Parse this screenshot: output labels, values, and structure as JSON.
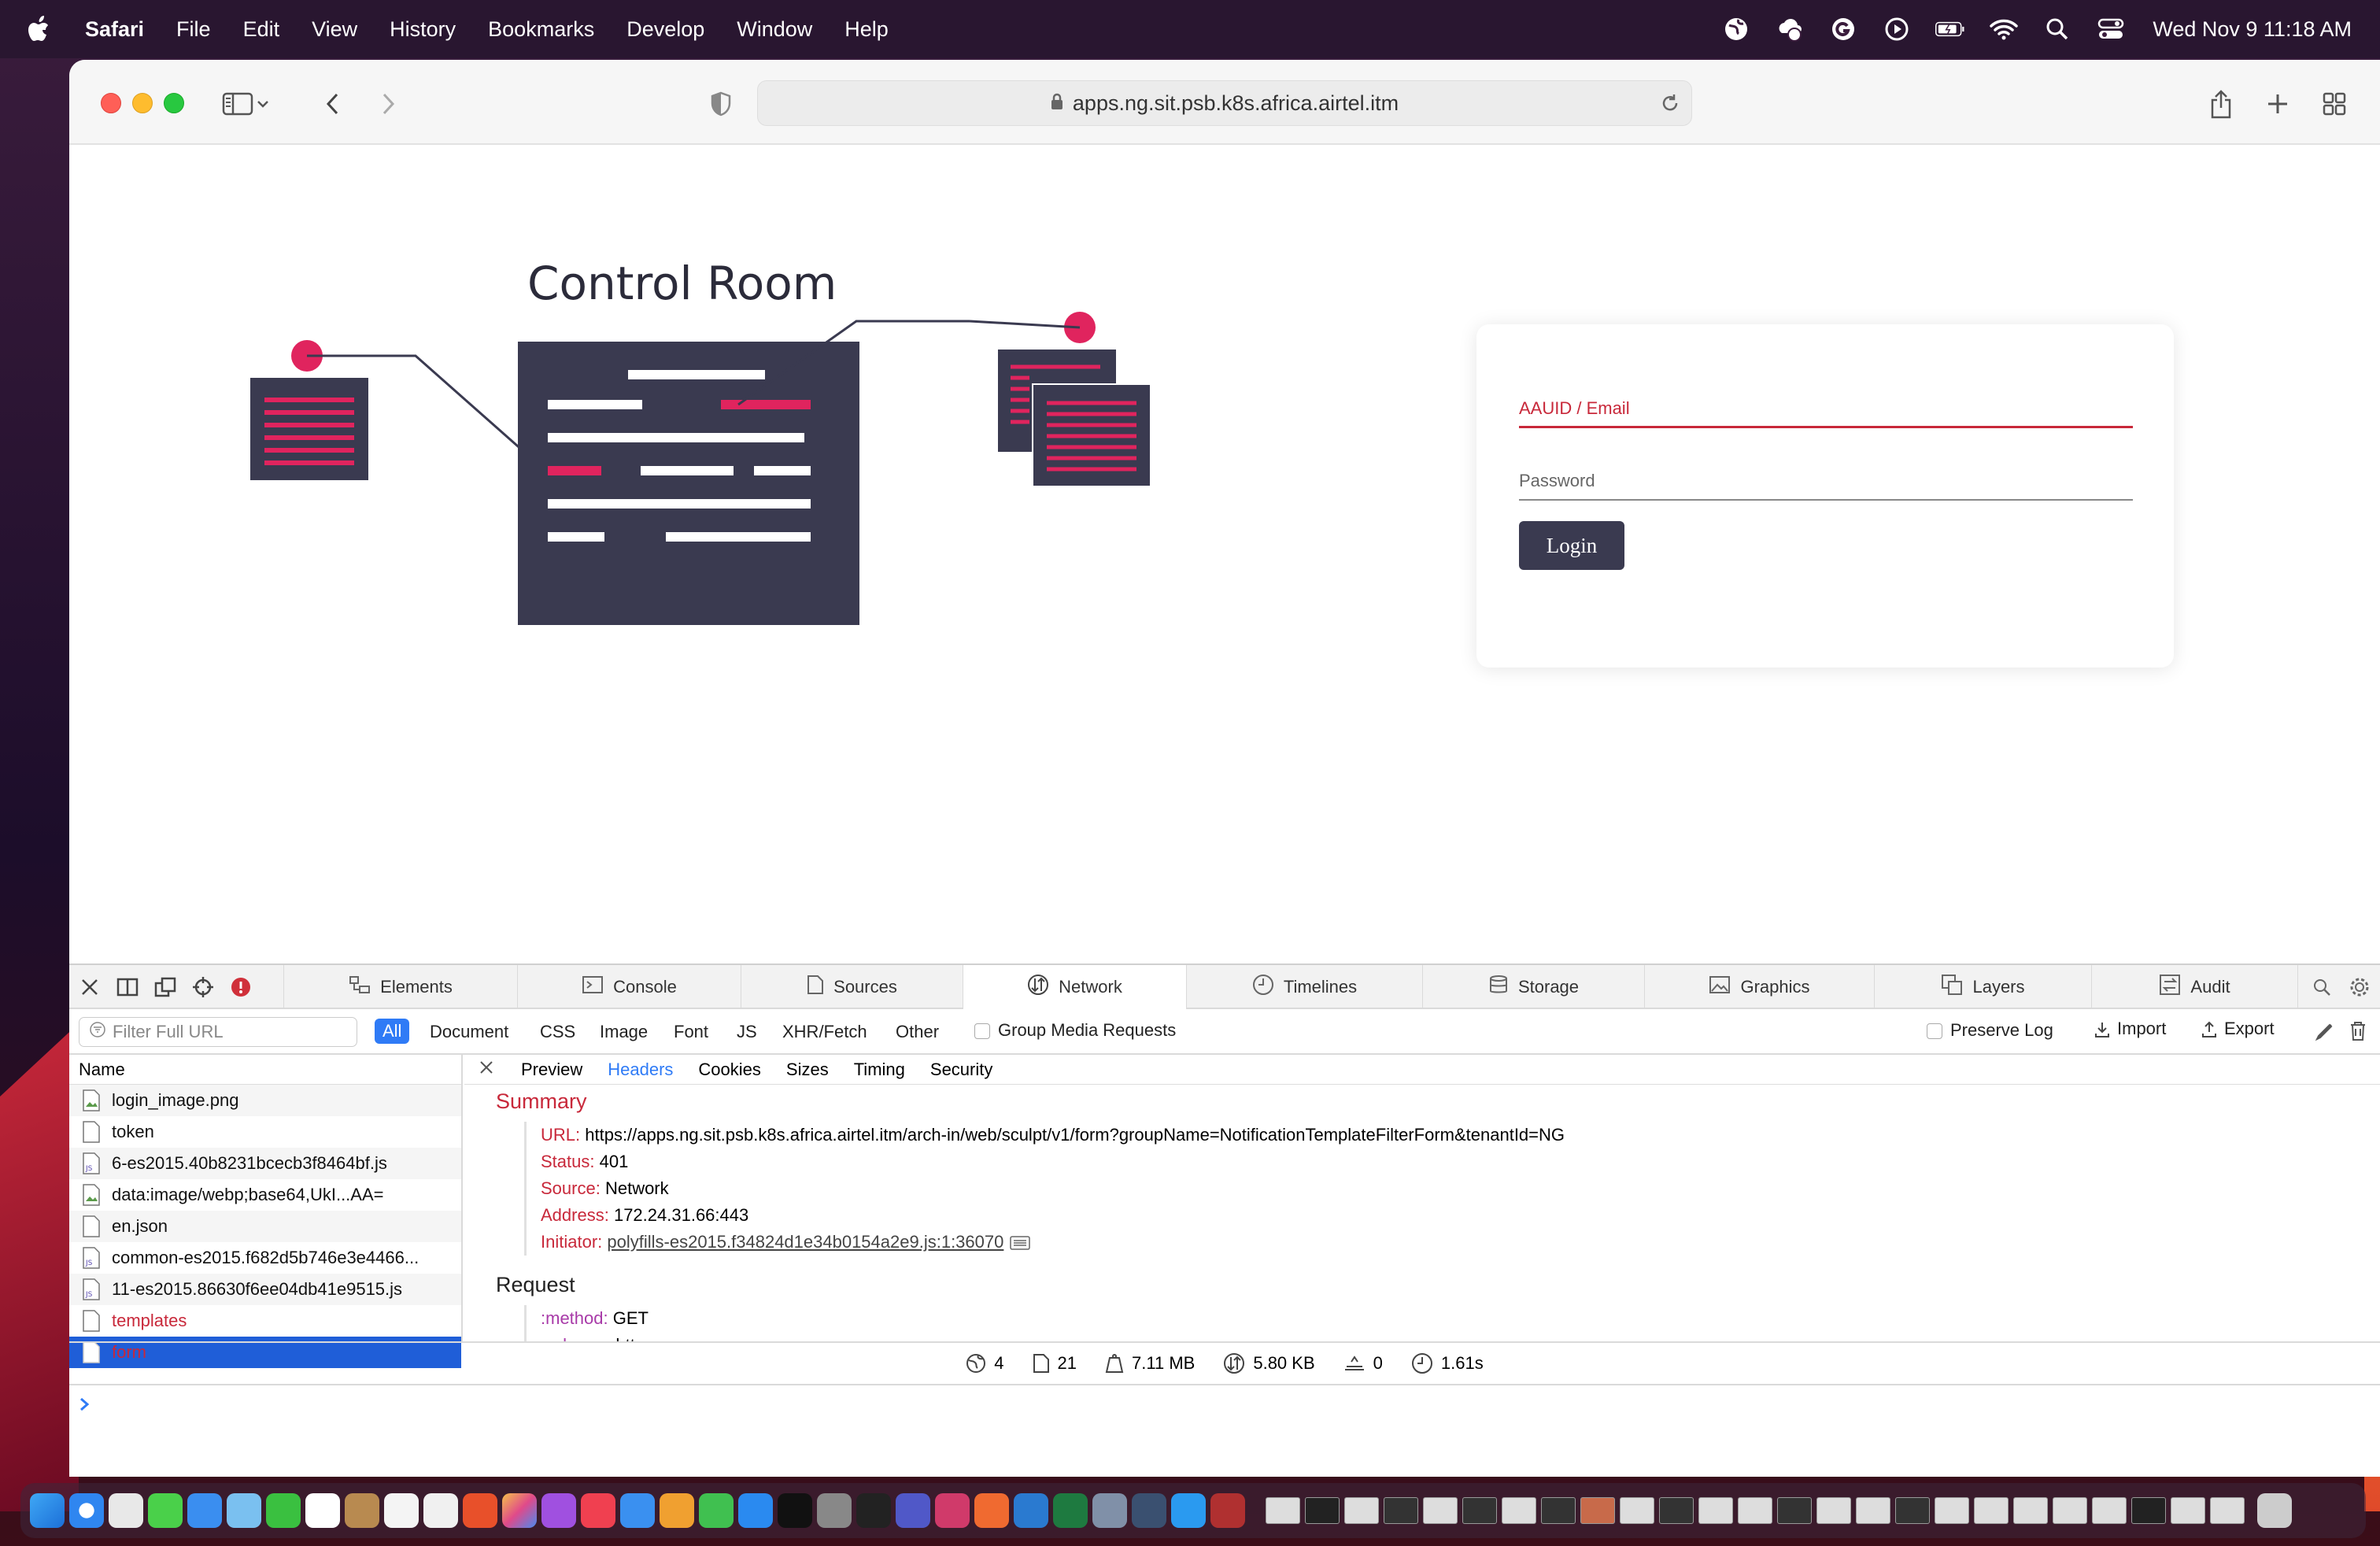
{
  "menubar": {
    "app": "Safari",
    "items": [
      "File",
      "Edit",
      "View",
      "History",
      "Bookmarks",
      "Develop",
      "Window",
      "Help"
    ],
    "clock": "Wed Nov 9  11:18 AM"
  },
  "browser": {
    "url": "apps.ng.sit.psb.k8s.africa.airtel.itm"
  },
  "page": {
    "title": "Control Room",
    "email_label": "AAUID / Email",
    "password_label": "Password",
    "login_label": "Login",
    "accent": "#e0245e",
    "illustration_color": "#3a3a50"
  },
  "devtools": {
    "tabs": [
      "Elements",
      "Console",
      "Sources",
      "Network",
      "Timelines",
      "Storage",
      "Graphics",
      "Layers",
      "Audit"
    ],
    "active_tab": "Network",
    "filter_placeholder": "Filter Full URL",
    "filters": [
      "All",
      "Document",
      "CSS",
      "Image",
      "Font",
      "JS",
      "XHR/Fetch",
      "Other"
    ],
    "group_media": "Group Media Requests",
    "preserve_log": "Preserve Log",
    "import": "Import",
    "export": "Export",
    "list_header": "Name",
    "requests": [
      {
        "name": "login_image.png",
        "type": "image"
      },
      {
        "name": "token",
        "type": "doc"
      },
      {
        "name": "6-es2015.40b8231bcecb3f8464bf.js",
        "type": "js"
      },
      {
        "name": "data:image/webp;base64,UkI...AA=",
        "type": "image"
      },
      {
        "name": "en.json",
        "type": "doc"
      },
      {
        "name": "common-es2015.f682d5b746e3e4466...",
        "type": "js"
      },
      {
        "name": "11-es2015.86630f6ee04db41e9515.js",
        "type": "js"
      },
      {
        "name": "templates",
        "type": "err"
      },
      {
        "name": "form",
        "type": "sel"
      }
    ],
    "detail_tabs": [
      "Preview",
      "Headers",
      "Cookies",
      "Sizes",
      "Timing",
      "Security"
    ],
    "active_detail_tab": "Headers",
    "summary_title": "Summary",
    "summary": {
      "url_k": "URL:",
      "url_v": "https://apps.ng.sit.psb.k8s.africa.airtel.itm/arch-in/web/sculpt/v1/form?groupName=NotificationTemplateFilterForm&tenantId=NG",
      "status_k": "Status:",
      "status_v": "401",
      "source_k": "Source:",
      "source_v": "Network",
      "address_k": "Address:",
      "address_v": "172.24.31.66:443",
      "initiator_k": "Initiator:",
      "initiator_v": "polyfills-es2015.f34824d1e34b0154a2e9.js:1:36070"
    },
    "request_title": "Request",
    "request": {
      "method_k": ":method:",
      "method_v": "GET",
      "scheme_k": ":scheme:",
      "scheme_v": "https"
    },
    "status_bar": {
      "domains": "4",
      "resources": "21",
      "size": "7.11 MB",
      "transferred": "5.80 KB",
      "redirects": "0",
      "time": "1.61s"
    }
  }
}
